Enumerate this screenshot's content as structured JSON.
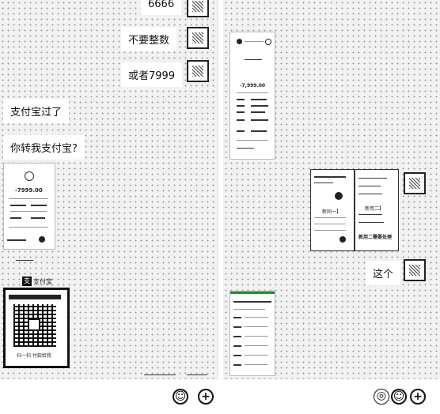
{
  "left": {
    "messages": {
      "top_partial": "6666",
      "no_round": "不要整数",
      "or_7999": "或者7999",
      "alipay_done": "支付宝过了",
      "transfer_ask": "你转我支付宝?"
    },
    "receipt": {
      "amount": "-7999.00",
      "alipay_brand": "支付宝",
      "qr_caption": "扫一扫 付款给我"
    },
    "input_bar": {
      "emoji_label": "☺",
      "add_label": "+"
    }
  },
  "right": {
    "receipt": {
      "amount": "-7,999.00"
    },
    "app_shot": {
      "left_item": "新同一】",
      "right_item": "新用二】",
      "banner": "新用二需要处理"
    },
    "messages": {
      "this_one": "这个"
    },
    "input_bar": {
      "voice_label": "◎",
      "emoji_label": "☺",
      "add_label": "+"
    }
  },
  "colors": {
    "pane_bg": "#f1f1f1",
    "bubble": "#ffffff",
    "accent_green": "#1f8f2f"
  }
}
